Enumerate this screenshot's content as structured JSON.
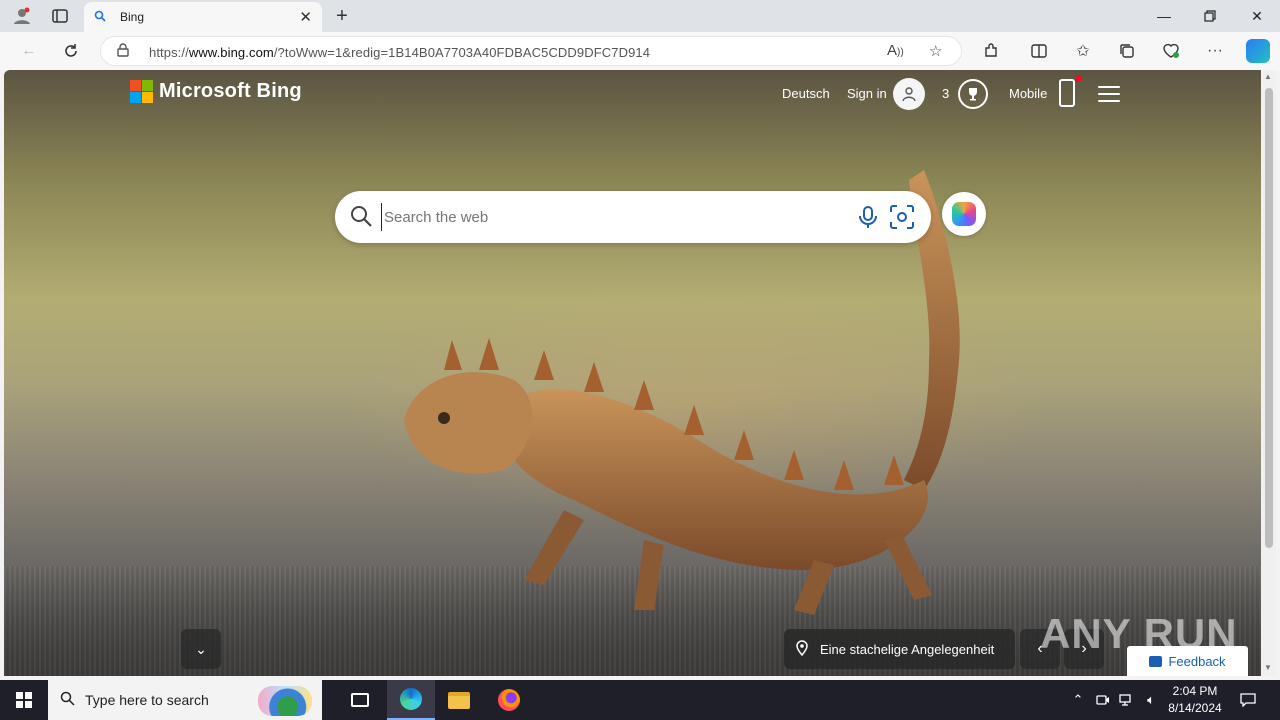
{
  "browser": {
    "tab": {
      "title": "Bing"
    },
    "address": {
      "url_prefix": "https://",
      "url_host": "www.bing.com",
      "url_rest": "/?toWww=1&redig=1B14B0A7703A40FDBAC5CDD9DFC7D914"
    }
  },
  "bing": {
    "logo_text": "Microsoft Bing",
    "header": {
      "language": "Deutsch",
      "sign_in": "Sign in",
      "rewards_count": "3",
      "mobile": "Mobile"
    },
    "search": {
      "placeholder": "Search the web"
    },
    "caption": "Eine stachelige Angelegenheit",
    "feedback": "Feedback"
  },
  "overlay": {
    "watermark": "ANY RUN"
  },
  "taskbar": {
    "search_placeholder": "Type here to search",
    "time": "2:04 PM",
    "date": "8/14/2024"
  },
  "colors": {
    "accent": "#1a73e8",
    "taskbar": "#1f1f2a",
    "notification_dot": "#e81123"
  }
}
